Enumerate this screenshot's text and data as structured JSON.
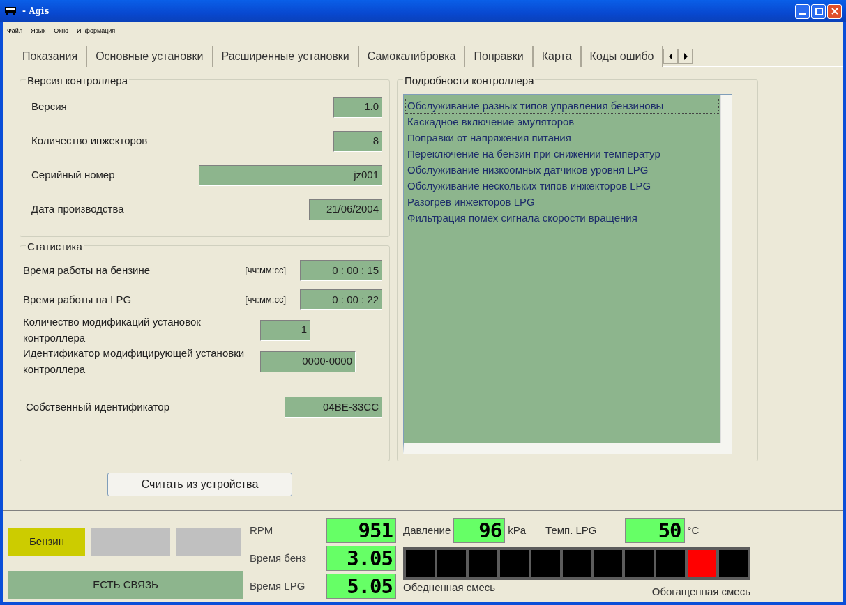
{
  "window": {
    "title": "- Agis"
  },
  "menu": [
    "Файл",
    "Язык",
    "Окно",
    "Информация"
  ],
  "tabs": [
    {
      "label": "Показания",
      "selected": false
    },
    {
      "label": "Основные установки",
      "selected": false
    },
    {
      "label": "Расширенные установки",
      "selected": false
    },
    {
      "label": "Самокалибровка",
      "selected": false
    },
    {
      "label": "Поправки",
      "selected": false
    },
    {
      "label": "Карта",
      "selected": false
    },
    {
      "label": "Коды ошибо",
      "selected": false
    }
  ],
  "version_group": {
    "title": "Версия контроллера",
    "fields": [
      {
        "label": "Версия",
        "value": "1.0"
      },
      {
        "label": "Количество инжекторов",
        "value": "8"
      },
      {
        "label": "Серийный номер",
        "value": "jz001"
      },
      {
        "label": "Дата производства",
        "value": "21/06/2004"
      }
    ]
  },
  "statistics_group": {
    "title": "Статистика",
    "fields": [
      {
        "label": "Время работы на бензине",
        "unit": "[чч:мм:сс]",
        "value": "0 : 00 : 15"
      },
      {
        "label": "Время работы на LPG",
        "unit": "[чч:мм:сс]",
        "value": "0 : 00 : 22"
      },
      {
        "label": "Количество модификаций установок контроллера",
        "value": "1"
      },
      {
        "label": "Идентификатор модифицирующей установки контроллера",
        "value": "0000-0000"
      },
      {
        "label": "Собственный идентификатор",
        "value": "04BE-33CC"
      }
    ]
  },
  "read_button": "Считать из устройства",
  "details_group": {
    "title": "Подробности контроллера",
    "items": [
      {
        "text": "Обслуживание разных типов управления бензиновы",
        "selected": true
      },
      {
        "text": "Каскадное включение эмуляторов",
        "selected": false
      },
      {
        "text": "Поправки от напряжения питания",
        "selected": false
      },
      {
        "text": "Переключение на бензин при снижении температур",
        "selected": false
      },
      {
        "text": "Обслуживание низкоомных датчиков уровня LPG",
        "selected": false
      },
      {
        "text": "Обслуживание нескольких типов инжекторов LPG",
        "selected": false
      },
      {
        "text": "Разогрев инжекторов LPG",
        "selected": false
      },
      {
        "text": "Фильтрация помех сигнала скорости вращения",
        "selected": false
      }
    ]
  },
  "status": {
    "indicators": [
      {
        "label": "Бензин",
        "color": "#cccc00"
      },
      {
        "color": "#c0c0c0"
      },
      {
        "color": "#c0c0c0"
      }
    ],
    "connection": "ЕСТЬ СВЯЗЬ",
    "readouts": [
      {
        "label": "RPM",
        "value": "951"
      },
      {
        "label": "Время бенз",
        "value": "3.05"
      },
      {
        "label": "Время LPG",
        "value": "5.05"
      }
    ],
    "pressure": {
      "label": "Давление",
      "value": "96",
      "unit": "kPa"
    },
    "lpg_temp": {
      "label": "Темп. LPG",
      "value": "50",
      "unit": "°C"
    },
    "mixture_cells": [
      {
        "on": false
      },
      {
        "on": false
      },
      {
        "on": false
      },
      {
        "on": false
      },
      {
        "on": false
      },
      {
        "on": false
      },
      {
        "on": false
      },
      {
        "on": false
      },
      {
        "on": false
      },
      {
        "on": true
      },
      {
        "on": false
      }
    ],
    "lean_label": "Обедненная смесь",
    "rich_label": "Обогащенная смесь"
  }
}
